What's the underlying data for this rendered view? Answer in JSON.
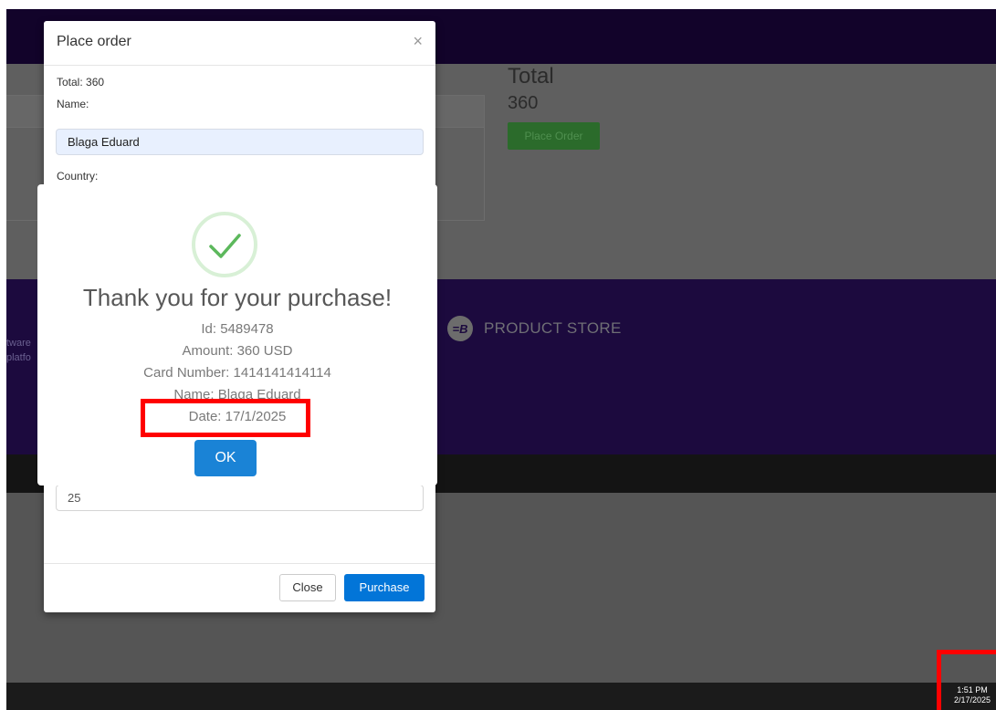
{
  "background": {
    "total_label": "Total",
    "total_value": "360",
    "place_order_label": "Place Order",
    "footer_left_lines": [
      "tware",
      "platfo"
    ],
    "brand_logo_text": "=B",
    "brand_name": "PRODUCT STORE"
  },
  "modal": {
    "title": "Place order",
    "close_symbol": "×",
    "total_text": "Total: 360",
    "name_label": "Name:",
    "name_value": "Blaga Eduard",
    "country_label": "Country:",
    "year_value": "25",
    "close_button": "Close",
    "purchase_button": "Purchase"
  },
  "alert": {
    "icon": "check-icon",
    "title": "Thank you for your purchase!",
    "id_line": "Id: 5489478",
    "amount_line": "Amount: 360 USD",
    "card_line": "Card Number: 1414141414114",
    "name_line": "Name: Blaga Eduard",
    "date_line": "Date: 17/1/2025",
    "ok_button": "OK"
  },
  "taskbar": {
    "time": "1:51 PM",
    "date": "2/17/2025"
  },
  "colors": {
    "header_purple": "#12032a",
    "footer_purple": "#1c0a3e",
    "primary_blue": "#0275d8",
    "ok_blue": "#1a83d6",
    "success_green": "#5cb85c",
    "highlight_red": "#ff0000"
  }
}
